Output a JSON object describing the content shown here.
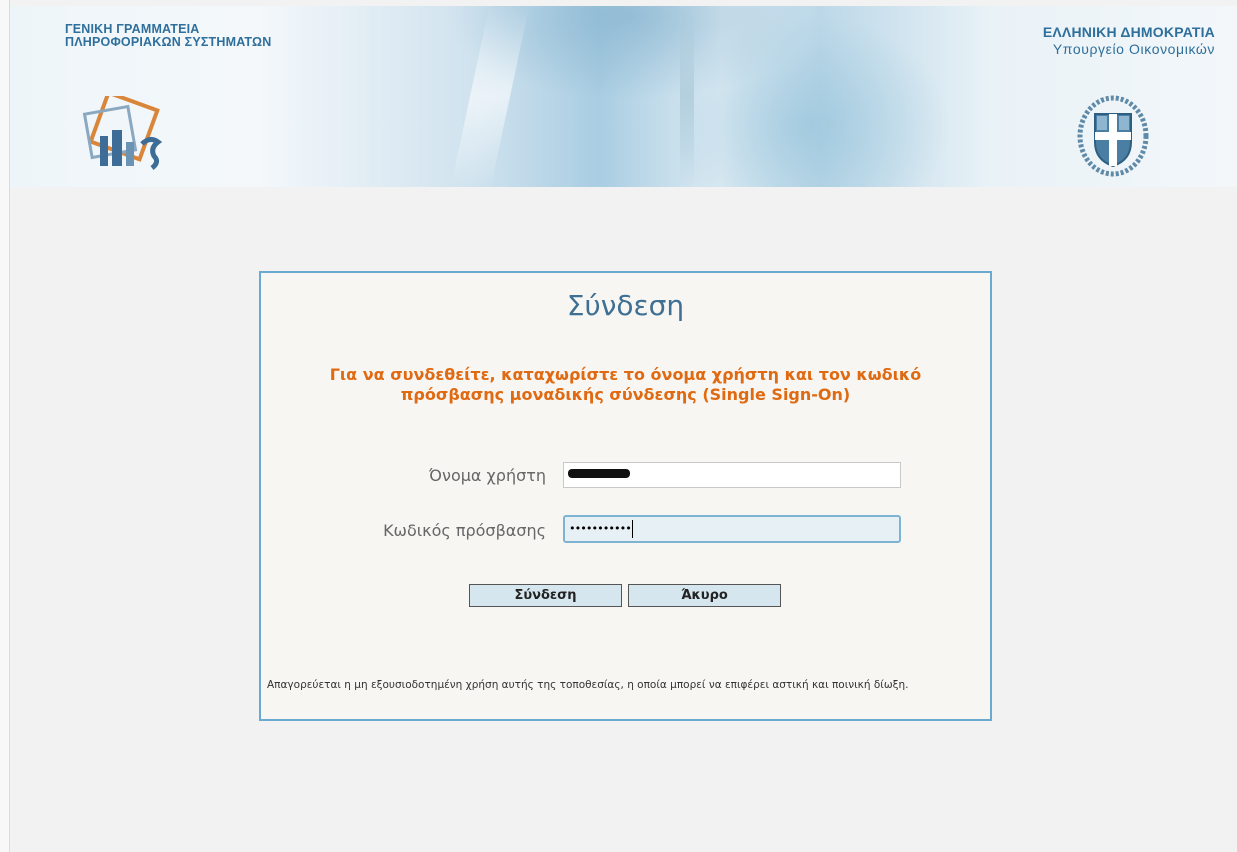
{
  "header": {
    "org_left_line1": "ΓΕΝΙΚΗ ΓΡΑΜΜΑΤΕΙΑ",
    "org_left_line2": "ΠΛΗΡΟΦΟΡΙΑΚΩΝ ΣΥΣΤΗΜΑΤΩΝ",
    "org_right_line1": "ΕΛΛΗΝΙΚΗ ΔΗΜΟΚΡΑΤΙΑ",
    "org_right_line2": "Υπουργείο Οικονομικών",
    "logo_left_icon": "gsis-logo-icon",
    "logo_right_icon": "greek-emblem-icon"
  },
  "login": {
    "title": "Σύνδεση",
    "instructions": "Για να συνδεθείτε, καταχωρίστε το όνομα χρήστη και τον κωδικό πρόσβασης μοναδικής σύνδεσης (Single Sign-On)",
    "username_label": "Όνομα χρήστη",
    "password_label": "Κωδικός πρόσβασης",
    "username_value": "(redacted)",
    "password_value": "•••••••••••",
    "submit_label": "Σύνδεση",
    "cancel_label": "Άκυρο",
    "disclaimer": "Απαγορεύεται η μη εξουσιοδοτημένη χρήση αυτής της τοποθεσίας, η οποία μπορεί να επιφέρει αστική και ποινική δίωξη."
  },
  "colors": {
    "brand_blue": "#2e6f9c",
    "title_blue": "#3f6f92",
    "instruction_orange": "#e06a12",
    "box_border": "#6aaad0",
    "button_bg": "#d6e6ef"
  }
}
